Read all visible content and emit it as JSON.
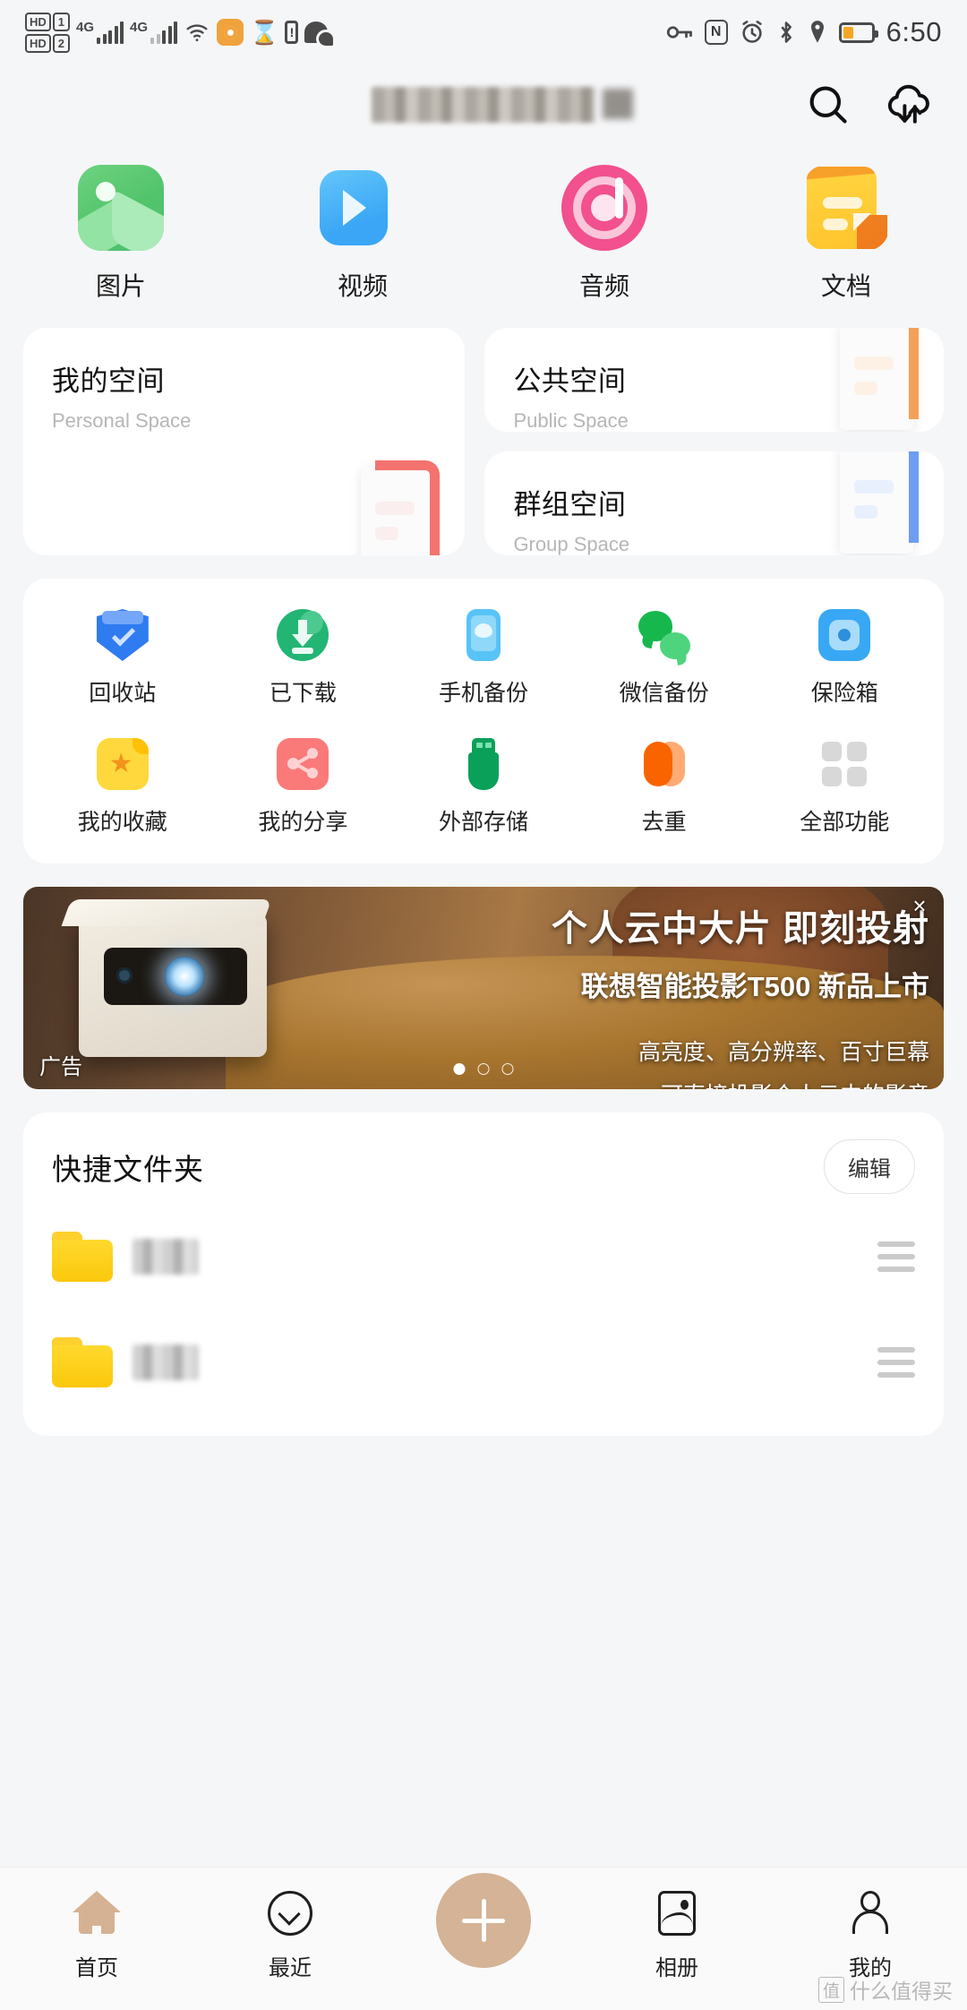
{
  "statusbar": {
    "hd1": "HD",
    "sim1": "1",
    "hd2": "HD",
    "sim2": "2",
    "net1": "4G",
    "net2": "4G",
    "time": "6:50",
    "icons": [
      "hd-dual-sim",
      "signal-4g-1",
      "signal-4g-2",
      "wifi",
      "camera-active",
      "hourglass",
      "sim-alert",
      "wechat",
      "vpn-key",
      "nfc",
      "alarm",
      "bluetooth",
      "location",
      "battery"
    ]
  },
  "header": {
    "title_redacted": "",
    "search_label": "搜索",
    "cloud_label": "传输列表"
  },
  "categories": [
    {
      "label": "图片",
      "icon": "picture-icon"
    },
    {
      "label": "视频",
      "icon": "video-icon"
    },
    {
      "label": "音频",
      "icon": "audio-icon"
    },
    {
      "label": "文档",
      "icon": "document-icon"
    }
  ],
  "spaces": [
    {
      "title": "我的空间",
      "subtitle": "Personal Space",
      "color": "#f4736f"
    },
    {
      "title": "公共空间",
      "subtitle": "Public Space",
      "color": "#f5a05a"
    },
    {
      "title": "群组空间",
      "subtitle": "Group Space",
      "color": "#6d9ef0"
    }
  ],
  "functions": [
    {
      "label": "回收站",
      "icon": "recycle-bin-icon"
    },
    {
      "label": "已下载",
      "icon": "downloaded-icon"
    },
    {
      "label": "手机备份",
      "icon": "phone-backup-icon"
    },
    {
      "label": "微信备份",
      "icon": "wechat-backup-icon"
    },
    {
      "label": "保险箱",
      "icon": "safe-box-icon"
    },
    {
      "label": "我的收藏",
      "icon": "favorites-icon"
    },
    {
      "label": "我的分享",
      "icon": "my-shares-icon"
    },
    {
      "label": "外部存储",
      "icon": "external-storage-icon"
    },
    {
      "label": "去重",
      "icon": "deduplicate-icon"
    },
    {
      "label": "全部功能",
      "icon": "all-functions-icon"
    }
  ],
  "ad": {
    "headline": "个人云中大片 即刻投射",
    "subhead": "联想智能投影T500 新品上市",
    "line3": "高亮度、高分辨率、百寸巨幕",
    "line4": "可直接投影个人云中的影音",
    "tag": "广告",
    "close": "×",
    "dots": 3,
    "active_dot": 0
  },
  "quick_folders": {
    "title": "快捷文件夹",
    "edit_label": "编辑",
    "items": [
      {
        "name_redacted": "",
        "icon": "folder-icon",
        "menu": "drag-handle-icon"
      },
      {
        "name_redacted": "",
        "icon": "folder-icon",
        "menu": "drag-handle-icon"
      }
    ]
  },
  "bottom_nav": {
    "items": [
      {
        "label": "首页",
        "icon": "home-icon",
        "active": true
      },
      {
        "label": "最近",
        "icon": "recent-icon",
        "active": false
      },
      {
        "label": "",
        "icon": "add-icon",
        "active": false
      },
      {
        "label": "相册",
        "icon": "album-icon",
        "active": false
      },
      {
        "label": "我的",
        "icon": "profile-icon",
        "active": false
      }
    ],
    "fab_color": "#d4b396"
  },
  "watermark": {
    "mark": "值",
    "text": "什么值得买"
  },
  "colors": {
    "page_bg": "#f5f6f8",
    "card_bg": "#ffffff",
    "accent": "#d4b396",
    "text_primary": "#111111",
    "text_secondary": "#b6b6b6"
  }
}
